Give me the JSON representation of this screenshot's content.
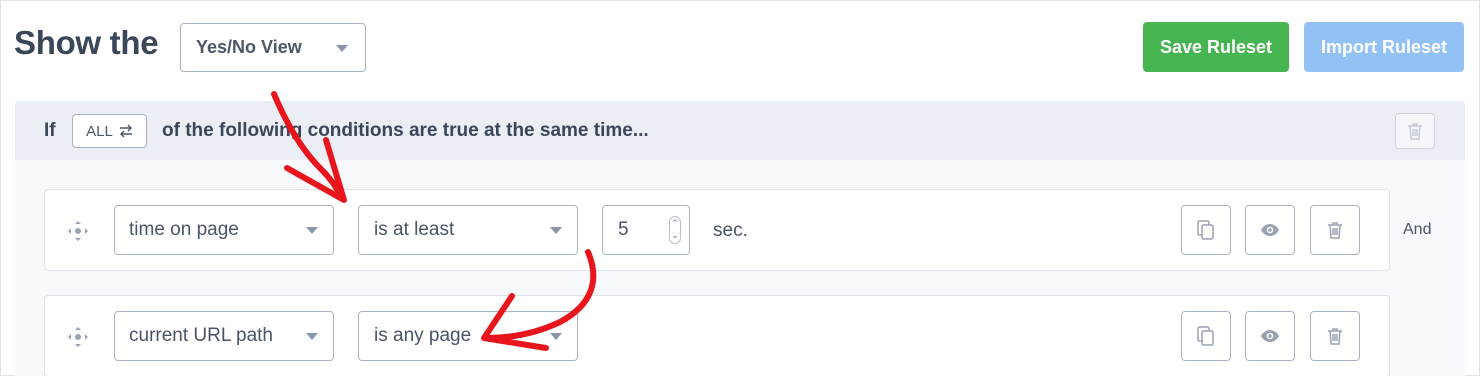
{
  "header": {
    "title": "Show the",
    "view_select": {
      "value": "Yes/No View"
    },
    "save_label": "Save Ruleset",
    "import_label": "Import Ruleset"
  },
  "group": {
    "if_label": "If",
    "match_toggle": {
      "label": "ALL",
      "icon": "swap-arrows-icon"
    },
    "condition_text": "of the following conditions are true at the same time..."
  },
  "rules": [
    {
      "field": "time on page",
      "operator": "is at least",
      "value": "5",
      "unit": "sec.",
      "connector": "And"
    },
    {
      "field": "current URL path",
      "operator": "is any page"
    }
  ],
  "colors": {
    "save": "#46b450",
    "import": "#92c1f3",
    "annotation": "#e8161c",
    "header_band": "#ebeef5"
  },
  "icons": [
    "drag-handle-icon",
    "copy-icon",
    "eye-icon",
    "trash-icon",
    "swap-arrows-icon"
  ]
}
